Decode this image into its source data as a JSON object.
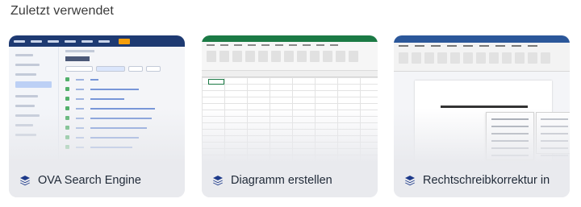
{
  "section": {
    "heading": "Zuletzt verwendet"
  },
  "cards": [
    {
      "title": "OVA Search Engine",
      "icon": "layers-icon",
      "thumbnail": "issues-list-screenshot"
    },
    {
      "title": "Diagramm erstellen",
      "icon": "layers-icon",
      "thumbnail": "spreadsheet-screenshot"
    },
    {
      "title": "Rechtschreibkorrektur in",
      "icon": "layers-icon",
      "thumbnail": "document-editor-screenshot"
    }
  ],
  "colors": {
    "icon": "#1e3a8a",
    "card_bg": "#e9eaee",
    "text": "#1f2937"
  }
}
